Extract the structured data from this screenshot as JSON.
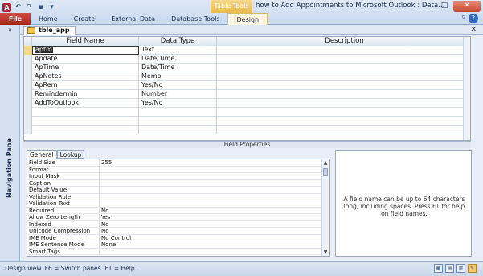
{
  "window": {
    "title": "how to Add Appointments to Microsoft Outlook : Data...",
    "context_tab_label": "Table Tools",
    "minimize": "‒",
    "maximize": "□",
    "close": "✕"
  },
  "quick_access": {
    "app_icon": "A",
    "undo": "↶",
    "redo": "↷",
    "save": "▪",
    "dropdown": "▾"
  },
  "ribbon": {
    "tabs": [
      {
        "label": "File"
      },
      {
        "label": "Home"
      },
      {
        "label": "Create"
      },
      {
        "label": "External Data"
      },
      {
        "label": "Database Tools"
      },
      {
        "label": "Design"
      }
    ],
    "collapse_caret": "▿",
    "help": "?"
  },
  "nav_pane": {
    "toggle": "»",
    "label": "Navigation Pane"
  },
  "document": {
    "tab_label": "tble_app",
    "close": "✕"
  },
  "grid": {
    "headers": {
      "field_name": "Field Name",
      "data_type": "Data Type",
      "description": "Description"
    },
    "rows": [
      {
        "name": "aptm",
        "type": "Text"
      },
      {
        "name": "Apdate",
        "type": "Date/Time"
      },
      {
        "name": "ApTime",
        "type": "Date/Time"
      },
      {
        "name": "ApNotes",
        "type": "Memo"
      },
      {
        "name": "ApRem",
        "type": "Yes/No"
      },
      {
        "name": "Remindermin",
        "type": "Number"
      },
      {
        "name": "AddToOutlook",
        "type": "Yes/No"
      }
    ]
  },
  "field_properties": {
    "title": "Field Properties",
    "tabs": [
      "General",
      "Lookup"
    ],
    "rows": [
      {
        "name": "Field Size",
        "value": "255"
      },
      {
        "name": "Format",
        "value": ""
      },
      {
        "name": "Input Mask",
        "value": ""
      },
      {
        "name": "Caption",
        "value": ""
      },
      {
        "name": "Default Value",
        "value": ""
      },
      {
        "name": "Validation Rule",
        "value": ""
      },
      {
        "name": "Validation Text",
        "value": ""
      },
      {
        "name": "Required",
        "value": "No"
      },
      {
        "name": "Allow Zero Length",
        "value": "Yes"
      },
      {
        "name": "Indexed",
        "value": "No"
      },
      {
        "name": "Unicode Compression",
        "value": "No"
      },
      {
        "name": "IME Mode",
        "value": "No Control"
      },
      {
        "name": "IME Sentence Mode",
        "value": "None"
      },
      {
        "name": "Smart Tags",
        "value": ""
      }
    ],
    "help_text": "A field name can be up to 64 characters long, including spaces. Press F1 for help on field names."
  },
  "status": {
    "text": "Design view.  F6 = Switch panes.  F1 = Help."
  }
}
